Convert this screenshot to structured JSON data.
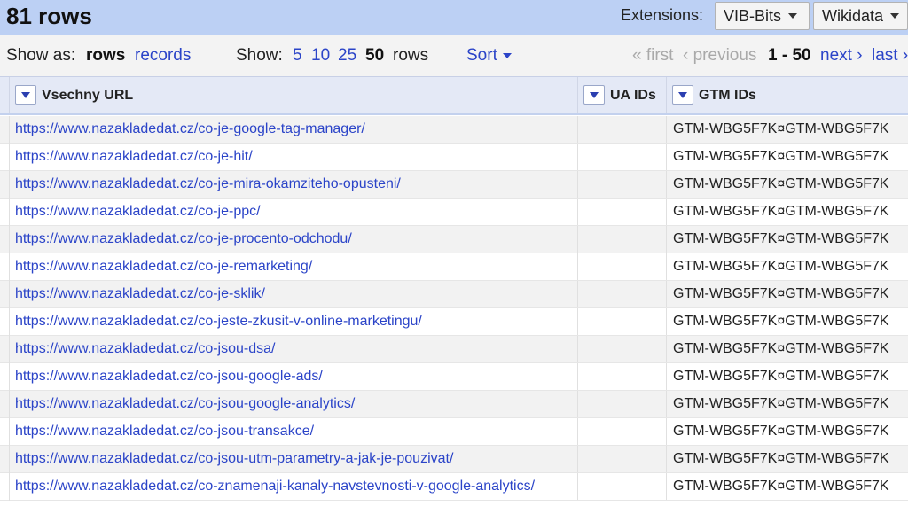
{
  "topbar": {
    "row_count": "81 rows",
    "extensions_label": "Extensions:",
    "ext_buttons": [
      "VIB-Bits",
      "Wikidata"
    ]
  },
  "viewbar": {
    "show_as_label": "Show as:",
    "mode_rows": "rows",
    "mode_records": "records",
    "show_label": "Show:",
    "page_sizes": [
      "5",
      "10",
      "25",
      "50"
    ],
    "selected_page_size": "50",
    "rows_suffix": "rows",
    "sort_label": "Sort",
    "pager": {
      "first": "« first",
      "previous": "‹ previous",
      "range": "1 - 50",
      "next": "next ›",
      "last": "last ›"
    }
  },
  "columns": [
    "Vsechny URL",
    "UA IDs",
    "GTM IDs"
  ],
  "rows": [
    {
      "url": "https://www.nazakladedat.cz/co-je-google-tag-manager/",
      "ua": "",
      "gtm": "GTM-WBG5F7K¤GTM-WBG5F7K"
    },
    {
      "url": "https://www.nazakladedat.cz/co-je-hit/",
      "ua": "",
      "gtm": "GTM-WBG5F7K¤GTM-WBG5F7K"
    },
    {
      "url": "https://www.nazakladedat.cz/co-je-mira-okamziteho-opusteni/",
      "ua": "",
      "gtm": "GTM-WBG5F7K¤GTM-WBG5F7K"
    },
    {
      "url": "https://www.nazakladedat.cz/co-je-ppc/",
      "ua": "",
      "gtm": "GTM-WBG5F7K¤GTM-WBG5F7K"
    },
    {
      "url": "https://www.nazakladedat.cz/co-je-procento-odchodu/",
      "ua": "",
      "gtm": "GTM-WBG5F7K¤GTM-WBG5F7K"
    },
    {
      "url": "https://www.nazakladedat.cz/co-je-remarketing/",
      "ua": "",
      "gtm": "GTM-WBG5F7K¤GTM-WBG5F7K"
    },
    {
      "url": "https://www.nazakladedat.cz/co-je-sklik/",
      "ua": "",
      "gtm": "GTM-WBG5F7K¤GTM-WBG5F7K"
    },
    {
      "url": "https://www.nazakladedat.cz/co-jeste-zkusit-v-online-marketingu/",
      "ua": "",
      "gtm": "GTM-WBG5F7K¤GTM-WBG5F7K"
    },
    {
      "url": "https://www.nazakladedat.cz/co-jsou-dsa/",
      "ua": "",
      "gtm": "GTM-WBG5F7K¤GTM-WBG5F7K"
    },
    {
      "url": "https://www.nazakladedat.cz/co-jsou-google-ads/",
      "ua": "",
      "gtm": "GTM-WBG5F7K¤GTM-WBG5F7K"
    },
    {
      "url": "https://www.nazakladedat.cz/co-jsou-google-analytics/",
      "ua": "",
      "gtm": "GTM-WBG5F7K¤GTM-WBG5F7K"
    },
    {
      "url": "https://www.nazakladedat.cz/co-jsou-transakce/",
      "ua": "",
      "gtm": "GTM-WBG5F7K¤GTM-WBG5F7K"
    },
    {
      "url": "https://www.nazakladedat.cz/co-jsou-utm-parametry-a-jak-je-pouzivat/",
      "ua": "",
      "gtm": "GTM-WBG5F7K¤GTM-WBG5F7K"
    },
    {
      "url": "https://www.nazakladedat.cz/co-znamenaji-kanaly-navstevnosti-v-google-analytics/",
      "ua": "",
      "gtm": "GTM-WBG5F7K¤GTM-WBG5F7K"
    }
  ]
}
